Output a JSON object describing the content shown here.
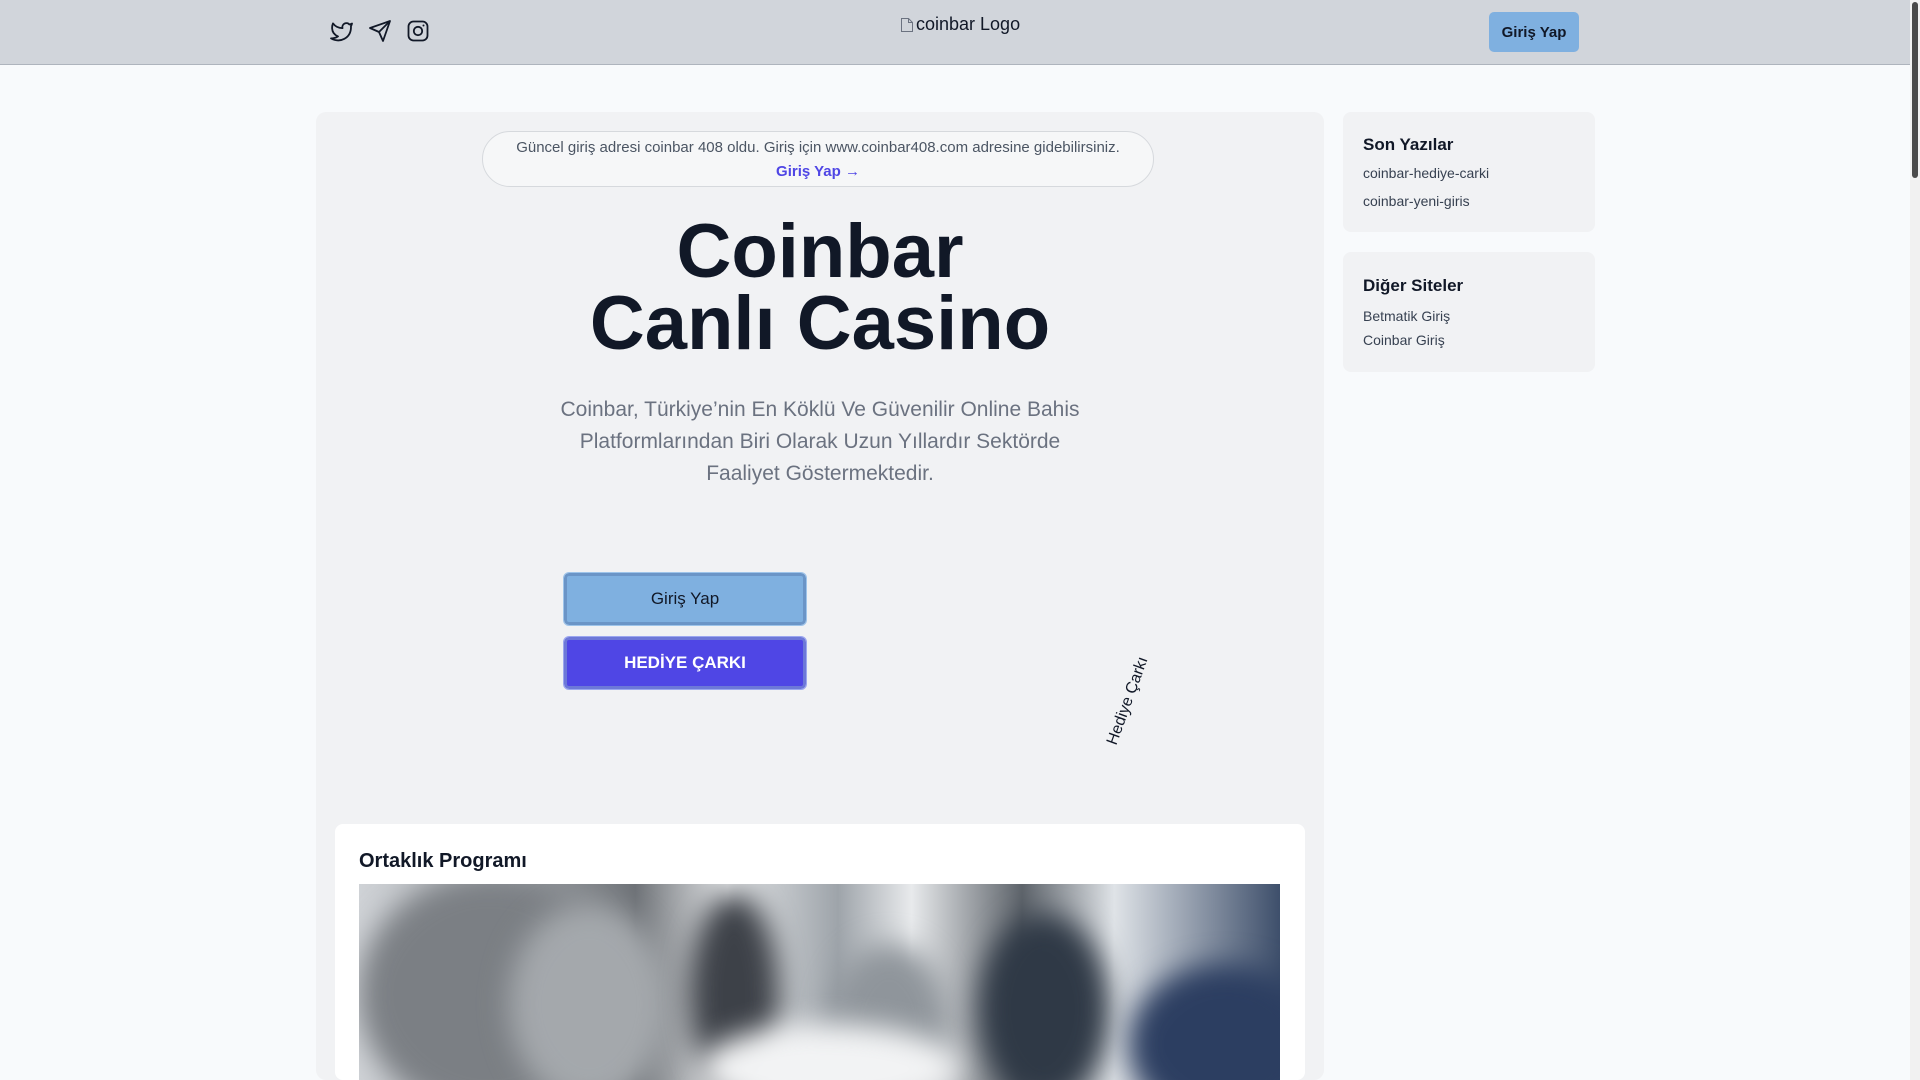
{
  "header": {
    "social_icons": [
      "twitter-icon",
      "send-icon",
      "instagram-icon"
    ],
    "logo_alt": "coinbar Logo",
    "login_label": "Giriş Yap"
  },
  "notice": {
    "text": "Güncel giriş adresi coinbar 408 oldu. Giriş için www.coinbar408.com adresine gidebilirsiniz.",
    "link_label": "Giriş Yap →"
  },
  "hero": {
    "title_line1": "Coinbar",
    "title_line2": "Canlı Casino",
    "subtitle": "Coinbar, Türkiye’nin En Köklü Ve Güvenilir Online Bahis Platformlarından Biri Olarak Uzun Yıllardır Sektörde Faaliyet Göstermektedir.",
    "login_button": "Giriş Yap",
    "wheel_button": "HEDİYE ÇARKI",
    "rotated_link": "Hediye Çarkı"
  },
  "card": {
    "title": "Ortaklık Programı"
  },
  "sidebar": {
    "recent": {
      "title": "Son Yazılar",
      "items": [
        "coinbar-hediye-carki",
        "coinbar-yeni-giris"
      ]
    },
    "other": {
      "title": "Diğer Siteler",
      "items": [
        "Betmatik Giriş",
        "Coinbar Giriş"
      ]
    }
  },
  "colors": {
    "accent": "#4f46e5",
    "login_blue": "#7fb0e0",
    "header_bg": "#d1d5db"
  }
}
